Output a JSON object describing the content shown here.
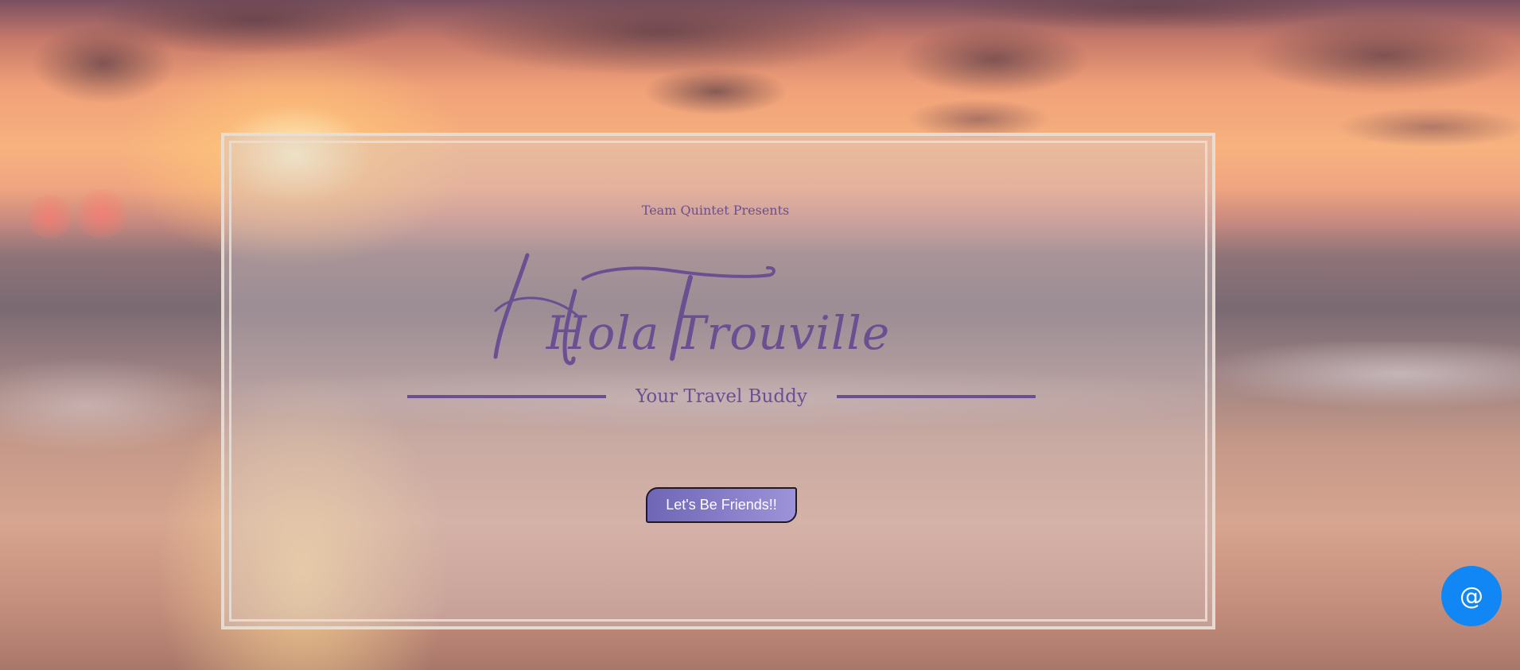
{
  "hero": {
    "presenter": "Team Quintet Presents",
    "title": "Hola Trouville",
    "tagline": "Your Travel Buddy",
    "cta_label": "Let's Be Friends!!"
  },
  "contact_button": {
    "label": "@",
    "color": "#1187f5"
  },
  "colors": {
    "accent": "#6a4f93",
    "frame": "#e8ded6",
    "button_gradient_start": "#6f66b6",
    "button_gradient_end": "#9d93d9"
  }
}
